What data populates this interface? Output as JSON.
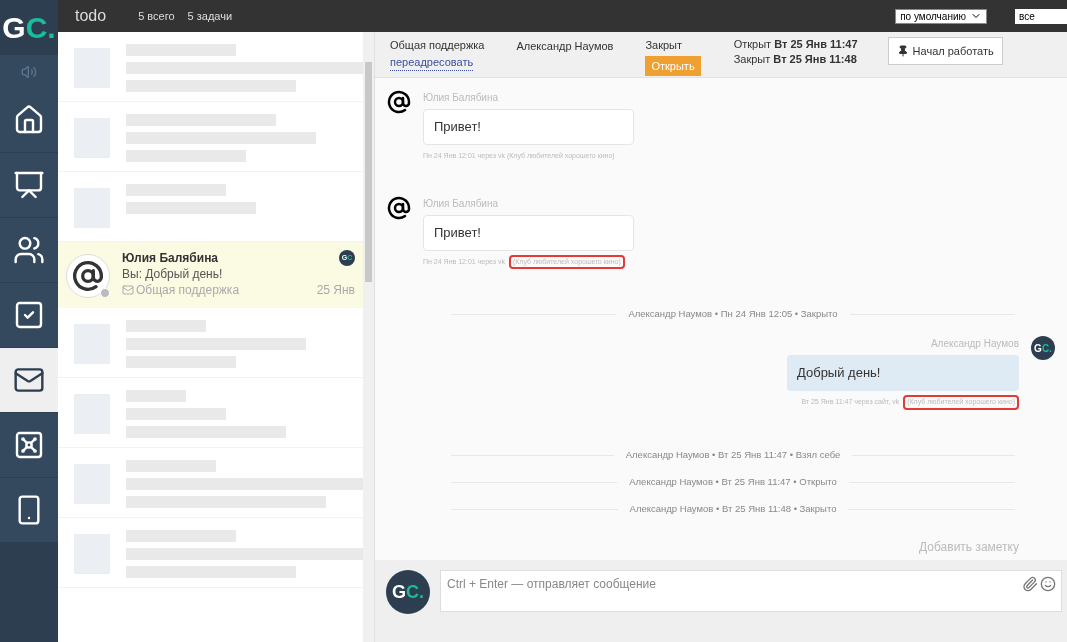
{
  "logo": {
    "letters": "G",
    "accent": "C."
  },
  "sidebar": {
    "items": [
      {
        "kind": "home",
        "selected": false
      },
      {
        "kind": "chart",
        "selected": false
      },
      {
        "kind": "users",
        "selected": false
      },
      {
        "kind": "tasks",
        "selected": false
      },
      {
        "kind": "mail",
        "selected": true
      },
      {
        "kind": "safe",
        "selected": false
      },
      {
        "kind": "phone",
        "selected": false
      }
    ]
  },
  "topbar": {
    "title": "todo",
    "counts": [
      "5 всего",
      "5 задачи"
    ],
    "sort": "по умолчанию",
    "filter": "все"
  },
  "conversations": [
    {
      "kind": "blurred",
      "selected": false
    },
    {
      "kind": "blurred",
      "selected": false
    },
    {
      "kind": "blurred",
      "selected": false
    },
    {
      "kind": "conversation",
      "selected": true,
      "name": "Юлия Балябина",
      "preview": "Вы: Добрый день!",
      "channel": "Общая поддержка",
      "date": "25 Янв",
      "agent_logo": {
        "letters": "G",
        "accent": "C"
      }
    },
    {
      "kind": "blurred",
      "selected": false
    },
    {
      "kind": "blurred",
      "selected": false
    },
    {
      "kind": "blurred",
      "selected": false
    },
    {
      "kind": "blurred",
      "selected": false
    }
  ],
  "chat_header": {
    "department": "Общая поддержка",
    "forward_link": "переадресовать",
    "assignee": "Александр Наумов",
    "status": "Закрыт",
    "reopen_button": "Открыть",
    "opened_label": "Открыт",
    "opened_at": "Вт 25 Янв 11:47",
    "closed_label": "Закрыт",
    "closed_at": "Вт 25 Янв 11:48",
    "start_button": "Начал работать"
  },
  "messages": [
    {
      "kind": "incoming",
      "author": "Юлия Балябина",
      "text": "Привет!",
      "meta": [
        {
          "text": "Пн 24 Янв 12:01 через vk (Клуб любителей хорошего кино)",
          "highlighted": false
        }
      ]
    },
    {
      "kind": "incoming",
      "author": "Юлия Балябина",
      "text": "Привет!",
      "meta": [
        {
          "text": "Пн 24 Янв 12:01 через vk",
          "highlighted": false
        },
        {
          "text": "(Клуб любителей хорошего кино)",
          "highlighted": true
        }
      ]
    },
    {
      "kind": "event",
      "text": "Александр Наумов • Пн 24 Янв 12:05 • Закрыто"
    },
    {
      "kind": "outgoing",
      "author": "Александр Наумов",
      "avatar": {
        "letters": "G",
        "accent": "C."
      },
      "text": "Добрый день!",
      "meta": [
        {
          "text": "Вт 25 Янв 11:47 через сайт, vk",
          "highlighted": false
        },
        {
          "text": "(Клуб любителей хорошего кино)",
          "highlighted": true
        }
      ]
    },
    {
      "kind": "event",
      "text": "Александр Наумов • Вт 25 Янв 11:47 • Взял себе"
    },
    {
      "kind": "event",
      "text": "Александр Наумов • Вт 25 Янв 11:47 • Открыто"
    },
    {
      "kind": "event",
      "text": "Александр Наумов • Вт 25 Янв 11:48 • Закрыто"
    }
  ],
  "add_note": "Добавить заметку",
  "composer": {
    "avatar": {
      "letters": "G",
      "accent": "C."
    },
    "placeholder": "Ctrl + Enter — отправляет сообщение"
  }
}
